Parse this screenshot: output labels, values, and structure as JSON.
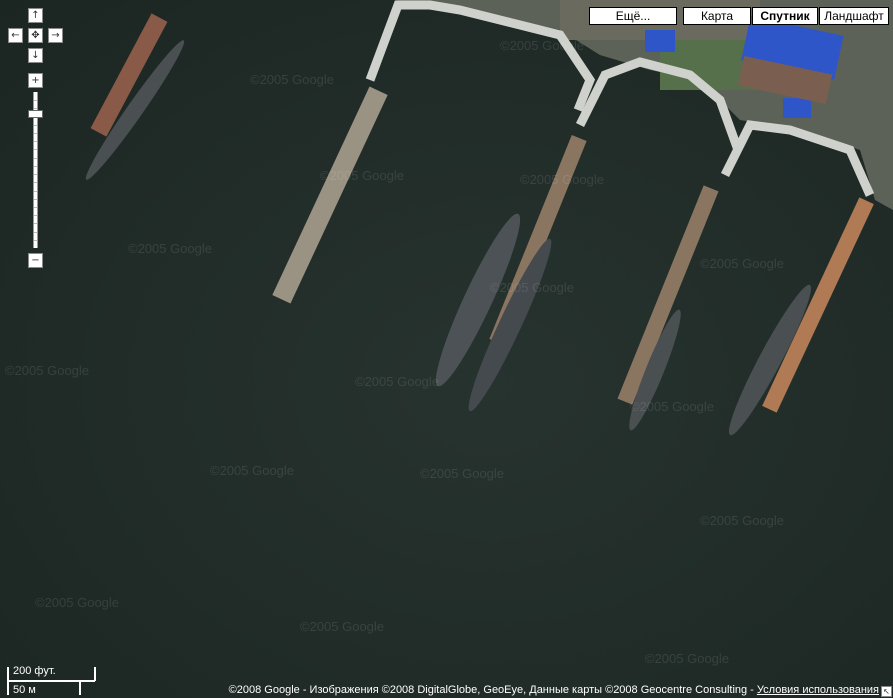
{
  "watermark": "©2005 Google",
  "navigation": {
    "pan_up": "↑",
    "pan_left": "←",
    "pan_center": "✥",
    "pan_right": "→",
    "pan_down": "↓",
    "zoom_in": "+",
    "zoom_out": "−"
  },
  "zoom": {
    "level_fraction": 0.88
  },
  "map_types": {
    "more": "Ещё...",
    "map": "Карта",
    "satellite": "Спутник",
    "terrain": "Ландшафт",
    "active": "satellite"
  },
  "scale": {
    "imperial": "200 фут.",
    "metric": "50 м"
  },
  "footer": {
    "copyright": "©2008 Google - Изображения ©2008 DigitalGlobe, GeoEye, Данные карты ©2008 Geocentre Consulting - ",
    "terms": "Условия использования",
    "corner": "↖"
  },
  "colors": {
    "water": "#222d29",
    "pier": "#8a7560",
    "quay": "#c9cbc6",
    "roof": "#2f56c8",
    "submarine": "#4a4f52"
  }
}
